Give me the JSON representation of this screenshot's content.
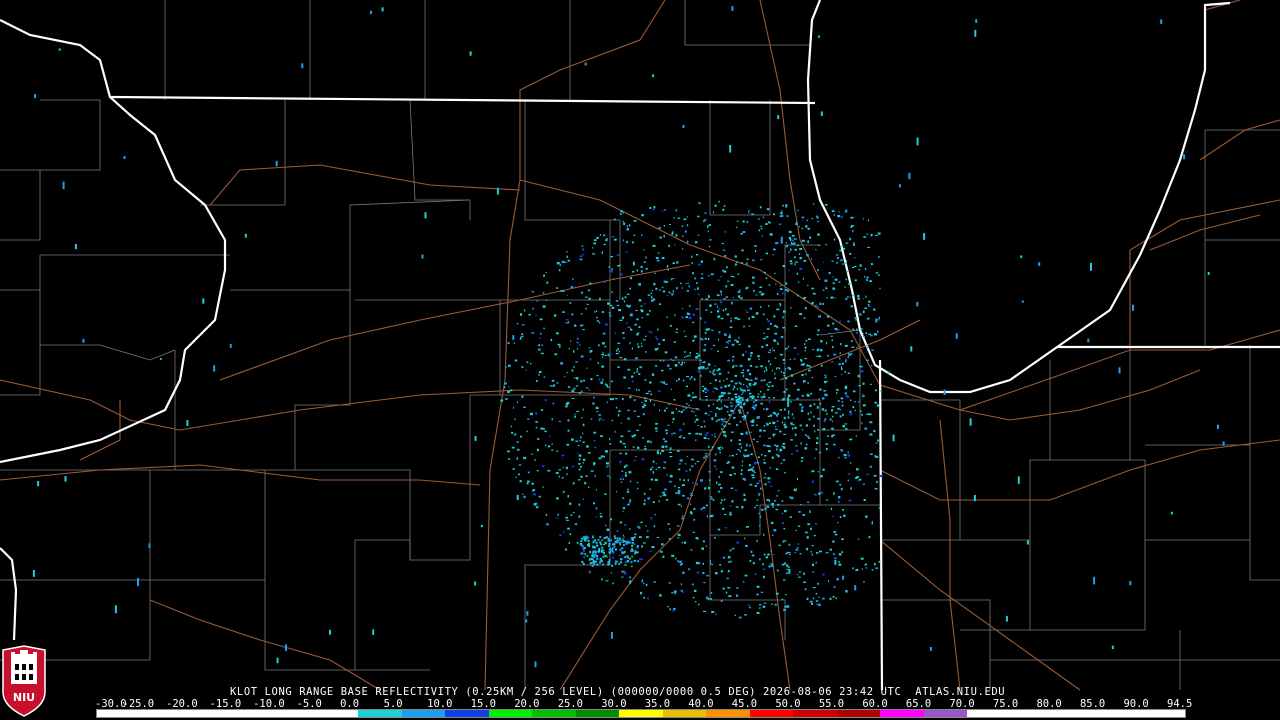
{
  "product": {
    "caption": "KLOT LONG RANGE BASE REFLECTIVITY (0.25KM / 256 LEVEL) (000000/0000 0.5 DEG) 2026-08-06 23:42 UTC  ATLAS.NIU.EDU",
    "logo_text": "NIU"
  },
  "scale": {
    "labels": [
      "-30.0",
      "-25.0",
      "-20.0",
      "-15.0",
      "-10.0",
      "-5.0",
      "0.0",
      "5.0",
      "10.0",
      "15.0",
      "20.0",
      "25.0",
      "30.0",
      "35.0",
      "40.0",
      "45.0",
      "50.0",
      "55.0",
      "60.0",
      "65.0",
      "70.0",
      "75.0",
      "80.0",
      "85.0",
      "90.0",
      "94.5"
    ],
    "colors": [
      "#ffffff",
      "#ffffff",
      "#ffffff",
      "#ffffff",
      "#ffffff",
      "#ffffff",
      "#20d0d8",
      "#1ea0f0",
      "#1040e8",
      "#00f000",
      "#00c000",
      "#008c00",
      "#ffff00",
      "#e8c000",
      "#ff9000",
      "#ff0000",
      "#d00000",
      "#b00000",
      "#ff00ff",
      "#9955c9",
      "#ffffff",
      "#ffffff",
      "#ffffff",
      "#ffffff",
      "#ffffff"
    ]
  },
  "map": {
    "background": "#000000",
    "state_border_color": "#ffffff",
    "county_line_color": "#808080",
    "highway_color": "#a0522d",
    "echo_colors": [
      "#20d0d8",
      "#1ea0f0",
      "#1040e8",
      "#00c000"
    ]
  }
}
